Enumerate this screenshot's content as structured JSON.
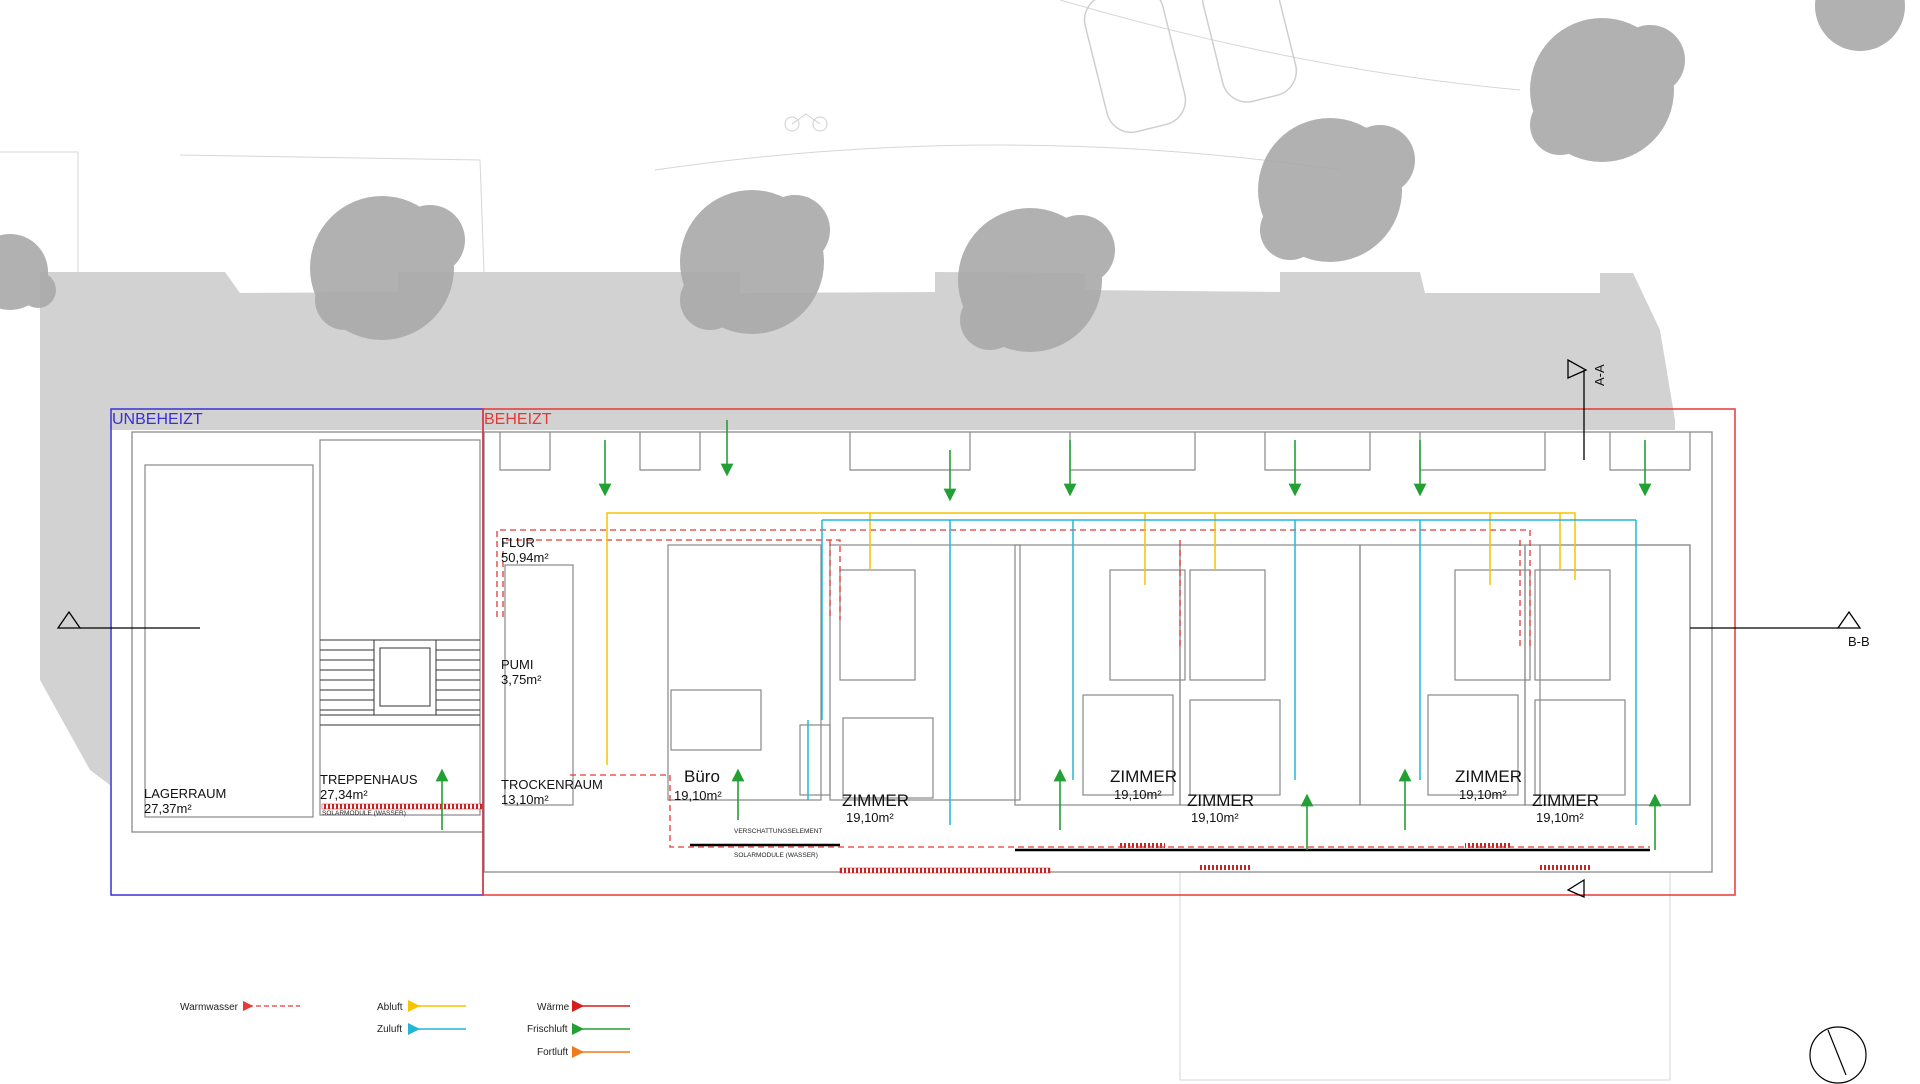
{
  "zones": {
    "unheated": "UNBEHEIZT",
    "heated": "BEHEIZT"
  },
  "sections": {
    "aa": "A-A",
    "bb": "B-B"
  },
  "rooms": [
    {
      "key": "lager",
      "name": "LAGERRAUM",
      "area": "27,37m²"
    },
    {
      "key": "treppe",
      "name": "TREPPENHAUS",
      "area": "27,34m²"
    },
    {
      "key": "flur",
      "name": "FLUR",
      "area": "50,94m²"
    },
    {
      "key": "pumi",
      "name": "PUMI",
      "area": "3,75m²"
    },
    {
      "key": "trocken",
      "name": "TROCKENRAUM",
      "area": "13,10m²"
    },
    {
      "key": "buero",
      "name": "Büro",
      "area": "19,10m²"
    },
    {
      "key": "z1",
      "name": "ZIMMER",
      "area": "19,10m²"
    },
    {
      "key": "z2",
      "name": "ZIMMER",
      "area": "19,10m²"
    },
    {
      "key": "z3",
      "name": "ZIMMER",
      "area": "19,10m²"
    },
    {
      "key": "z4",
      "name": "ZIMMER",
      "area": "19,10m²"
    },
    {
      "key": "z5",
      "name": "ZIMMER",
      "area": "19,10m²"
    }
  ],
  "annotations": {
    "solar_stair": "SOLARMODULE (WASSER)",
    "shading": "VERSCHATTUNGSELEMENT",
    "solar_main": "SOLARMODULE (WASSER)"
  },
  "legend": [
    {
      "key": "warmwasser",
      "label": "Warmwasser",
      "color": "#e53935",
      "style": "dashed"
    },
    {
      "key": "abluft",
      "label": "Abluft",
      "color": "#f5c400",
      "style": "solid"
    },
    {
      "key": "zuluft",
      "label": "Zuluft",
      "color": "#22b5d6",
      "style": "solid"
    },
    {
      "key": "waerme",
      "label": "Wärme",
      "color": "#d81b1b",
      "style": "solid"
    },
    {
      "key": "frischluft",
      "label": "Frischluft",
      "color": "#23a034",
      "style": "solid"
    },
    {
      "key": "fortluft",
      "label": "Fortluft",
      "color": "#f07a1a",
      "style": "solid"
    }
  ],
  "colors": {
    "unheated_zone": "#3a2fd6",
    "heated_zone": "#e53935",
    "shadow": "#cfcfcf",
    "tree": "#a8a8a8",
    "wall": "#8a8a8a"
  },
  "icons": [
    "tree-icon",
    "car-icon",
    "bicycle-icon",
    "north-arrow-icon",
    "section-marker-icon"
  ]
}
